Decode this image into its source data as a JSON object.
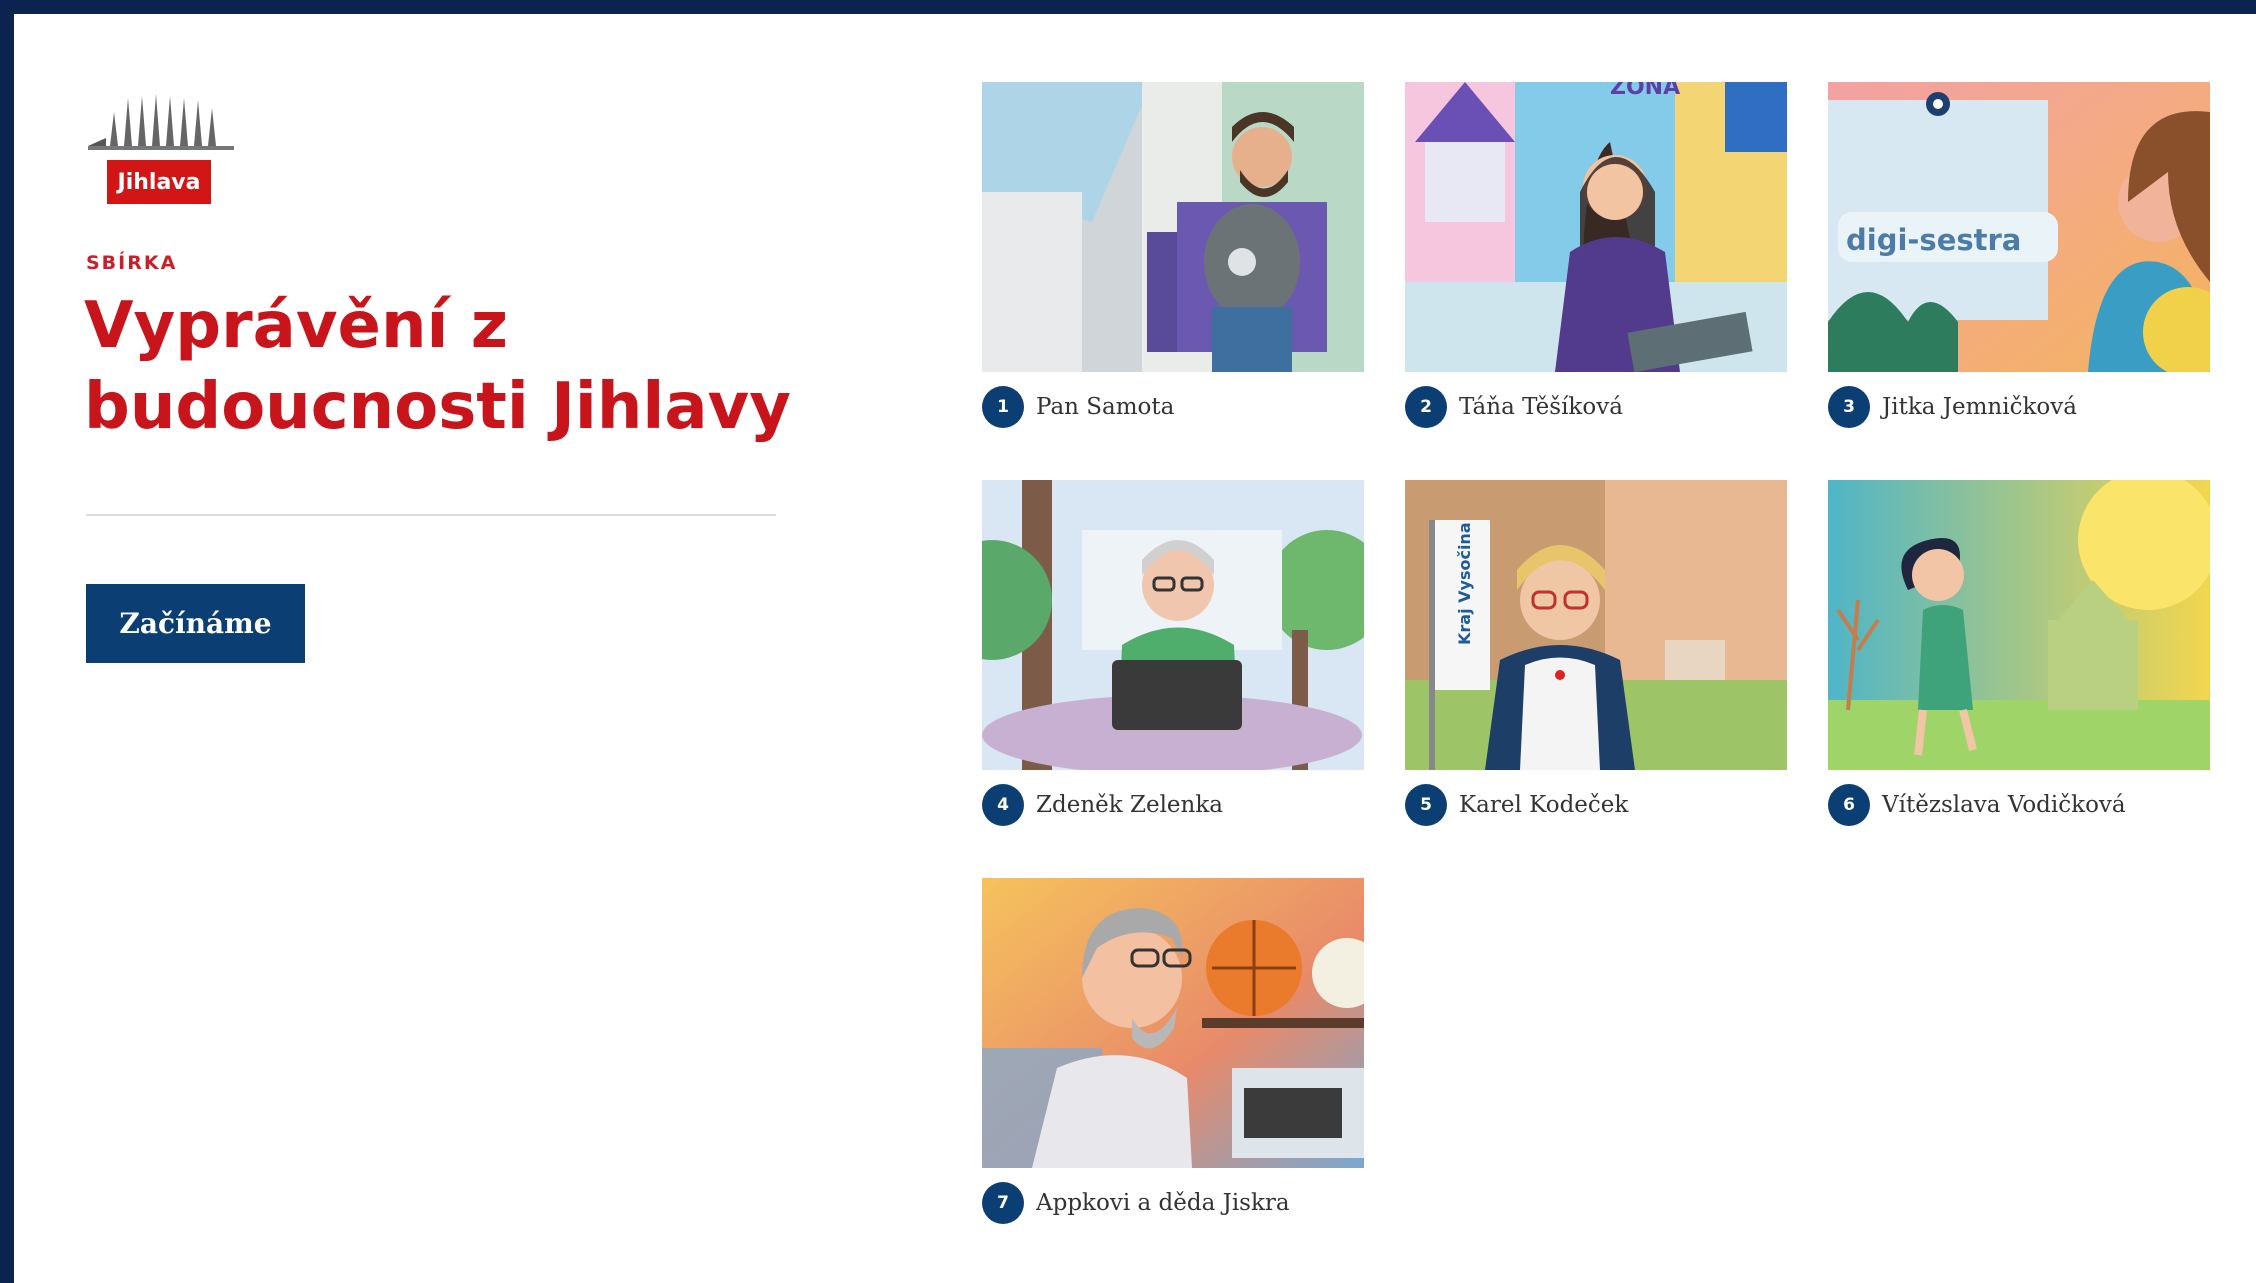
{
  "brand": {
    "logo_text": "Jihlava",
    "accent": "#c8151b",
    "primary": "#0b3f74"
  },
  "header": {
    "kicker": "SBÍRKA",
    "title_line1": "Vyprávění z",
    "title_line2": "budoucnosti Jihlavy"
  },
  "actions": {
    "start_label": "Začínáme"
  },
  "stories": [
    {
      "num": "1",
      "name": "Pan Samota"
    },
    {
      "num": "2",
      "name": "Táňa Těšíková"
    },
    {
      "num": "3",
      "name": "Jitka Jemničková"
    },
    {
      "num": "4",
      "name": "Zdeněk Zelenka"
    },
    {
      "num": "5",
      "name": "Karel Kodeček"
    },
    {
      "num": "6",
      "name": "Vítězslava Vodičková"
    },
    {
      "num": "7",
      "name": "Appkovi a děda Jiskra"
    }
  ],
  "illustrations": {
    "zona": "ZONA",
    "digi": "digi-sestra",
    "kraj": "Kraj Vysočina"
  }
}
